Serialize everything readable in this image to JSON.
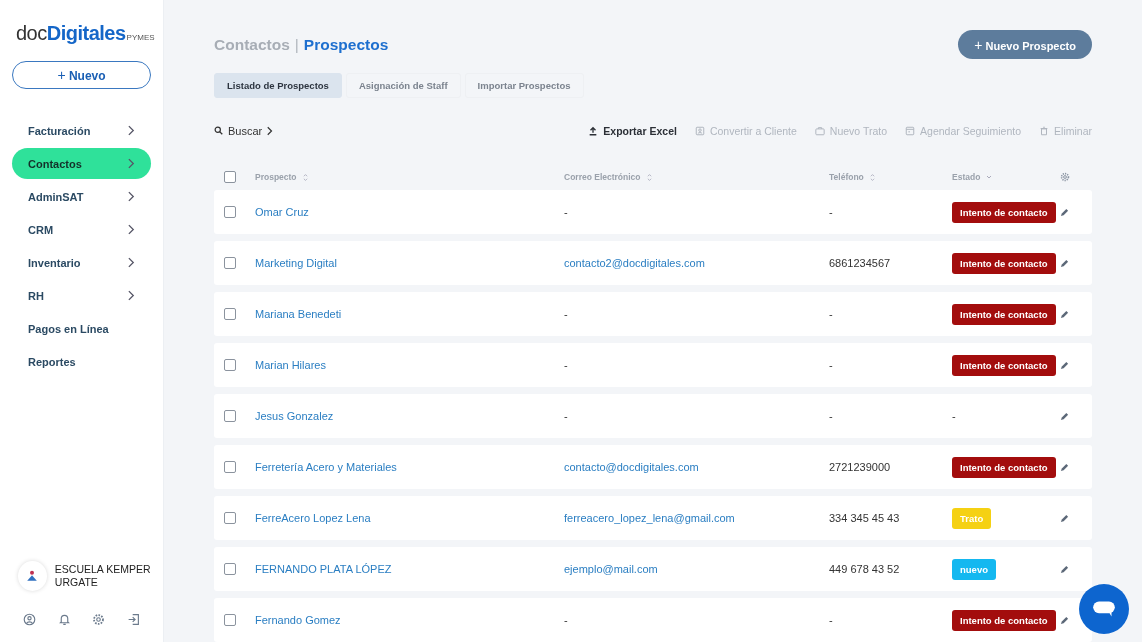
{
  "brand": {
    "name_prefix": "doc",
    "name_main": "Digitales",
    "suffix": "PYMES"
  },
  "new_button": {
    "icon": "+",
    "label": "Nuevo"
  },
  "sidebar": {
    "items": [
      {
        "label": "Facturación",
        "expandable": true,
        "selected": false
      },
      {
        "label": "Contactos",
        "expandable": true,
        "selected": true
      },
      {
        "label": "AdminSAT",
        "expandable": true,
        "selected": false
      },
      {
        "label": "CRM",
        "expandable": true,
        "selected": false
      },
      {
        "label": "Inventario",
        "expandable": true,
        "selected": false
      },
      {
        "label": "RH",
        "expandable": true,
        "selected": false
      },
      {
        "label": "Pagos en Línea",
        "expandable": false,
        "selected": false
      },
      {
        "label": "Reportes",
        "expandable": false,
        "selected": false
      }
    ]
  },
  "account": {
    "name": "ESCUELA KEMPER URGATE"
  },
  "breadcrumb": {
    "parent": "Contactos",
    "separator": "|",
    "current": "Prospectos"
  },
  "primary_button": {
    "icon": "+",
    "label": "Nuevo Prospecto"
  },
  "tabs": [
    {
      "label": "Listado de Prospectos",
      "selected": true
    },
    {
      "label": "Asignación de Staff",
      "selected": false
    },
    {
      "label": "Importar Prospectos",
      "selected": false
    }
  ],
  "search": {
    "label": "Buscar"
  },
  "actions": [
    {
      "kind": "export",
      "label": "Exportar Excel",
      "disabled": false
    },
    {
      "kind": "convert",
      "label": "Convertir a Cliente",
      "disabled": true
    },
    {
      "kind": "deal",
      "label": "Nuevo Trato",
      "disabled": true
    },
    {
      "kind": "schedule",
      "label": "Agendar Seguimiento",
      "disabled": true
    },
    {
      "kind": "delete",
      "label": "Eliminar",
      "disabled": true
    }
  ],
  "table": {
    "all_checked": false,
    "columns": [
      {
        "label": "Prospecto",
        "kind": "sortable"
      },
      {
        "label": "Correo Electrónico",
        "kind": "sortable"
      },
      {
        "label": "Teléfono",
        "kind": "sortable"
      },
      {
        "label": "Estado",
        "kind": "sorted"
      }
    ],
    "rows": [
      {
        "checked": false,
        "name": "Omar Cruz",
        "email": "-",
        "phone": "-",
        "status": "Intento de contacto",
        "color": "#a30d0d"
      },
      {
        "checked": false,
        "name": "Marketing Digital",
        "email": "contacto2@docdigitales.com",
        "phone": "6861234567",
        "status": "Intento de contacto",
        "color": "#a30d0d"
      },
      {
        "checked": false,
        "name": "Mariana Benedeti",
        "email": "-",
        "phone": "-",
        "status": "Intento de contacto",
        "color": "#a30d0d"
      },
      {
        "checked": false,
        "name": "Marian Hilares",
        "email": "-",
        "phone": "-",
        "status": "Intento de contacto",
        "color": "#a30d0d"
      },
      {
        "checked": false,
        "name": "Jesus Gonzalez",
        "email": "-",
        "phone": "-",
        "status": "-"
      },
      {
        "checked": false,
        "name": "Ferretería Acero y Materiales",
        "email": "contacto@docdigitales.com",
        "phone": "2721239000",
        "status": "Intento de contacto",
        "color": "#a30d0d"
      },
      {
        "checked": false,
        "name": "FerreAcero Lopez Lena",
        "email": "ferreacero_lopez_lena@gmail.com",
        "phone": "334 345 45 43",
        "status": "Trato",
        "color": "#f5d113"
      },
      {
        "checked": false,
        "name": "FERNANDO PLATA LÓPEZ",
        "email": "ejemplo@mail.com",
        "phone": "449 678 43 52",
        "status": "nuevo",
        "color": "#14b8f0"
      },
      {
        "checked": false,
        "name": "Fernando Gomez",
        "email": "-",
        "phone": "-",
        "status": "Intento de contacto",
        "color": "#a30d0d"
      }
    ]
  }
}
